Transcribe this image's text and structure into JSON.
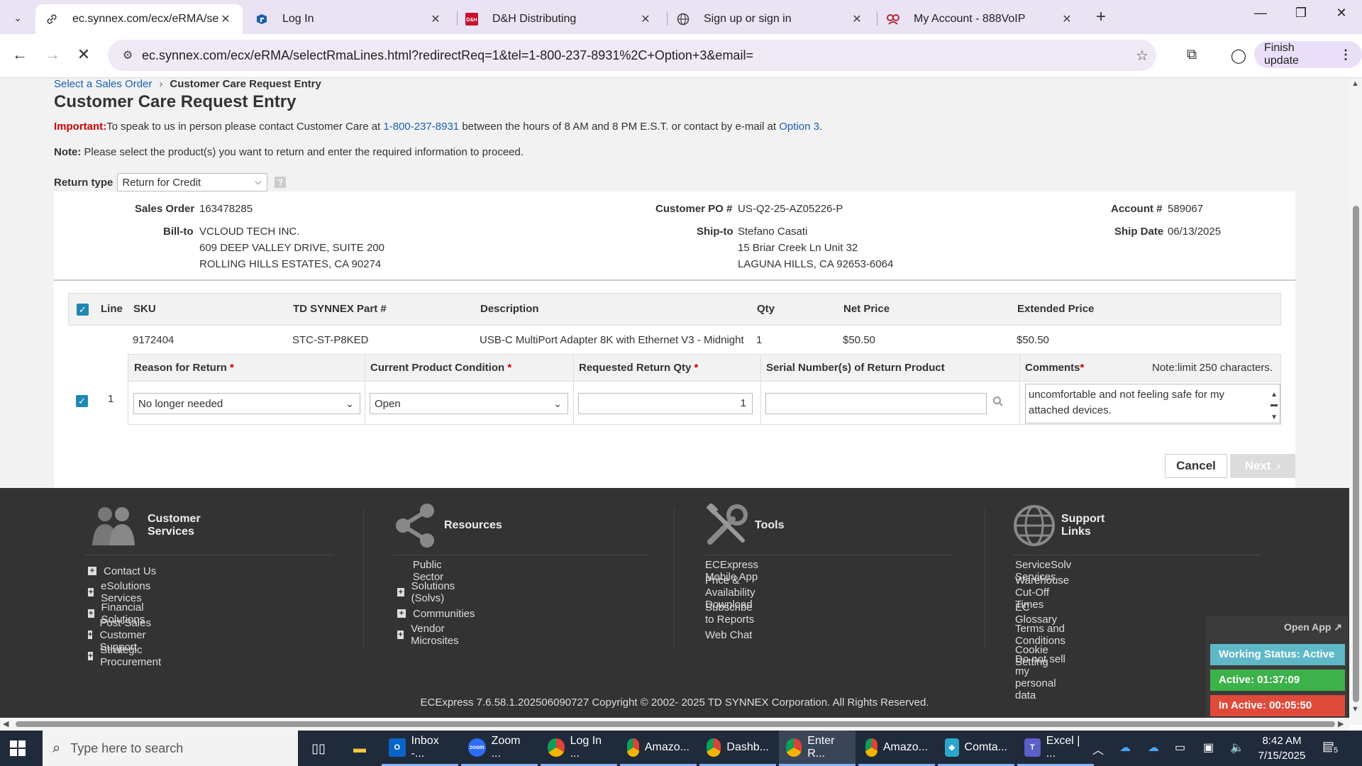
{
  "browser": {
    "tabs": [
      {
        "title": "ec.synnex.com/ecx/eRMA/selec",
        "active": true,
        "icon": "link-icon"
      },
      {
        "title": "Log In",
        "active": false,
        "icon": "app-icon"
      },
      {
        "title": "D&H Distributing",
        "active": false,
        "icon": "dh-icon"
      },
      {
        "title": "Sign up or sign in",
        "active": false,
        "icon": "globe-icon"
      },
      {
        "title": "My Account - 888VoIP",
        "active": false,
        "icon": "voip-icon"
      }
    ],
    "url": "ec.synnex.com/ecx/eRMA/selectRmaLines.html?redirectReq=1&tel=1-800-237-8931%2C+Option+3&email=",
    "finish_update": "Finish update"
  },
  "breadcrumb": {
    "link": "Select a Sales Order",
    "current": "Customer Care Request Entry"
  },
  "page_title": "Customer Care Request Entry",
  "important": {
    "label": "Important:",
    "text1": "To speak to us in person please contact Customer Care at ",
    "phone": "1-800-237-8931",
    "text2": " between the hours of 8 AM and 8 PM E.S.T. or contact by e-mail at ",
    "option": "Option 3",
    "text3": "."
  },
  "note": {
    "label": "Note:",
    "text": " Please select the product(s) you want to return and enter the required information to proceed."
  },
  "return_type": {
    "label": "Return type",
    "value": "Return for Credit",
    "help": "?"
  },
  "order": {
    "sales_order_label": "Sales Order",
    "sales_order": "163478285",
    "bill_to_label": "Bill-to",
    "bill_to": [
      "VCLOUD TECH INC.",
      "609 DEEP VALLEY DRIVE, SUITE 200",
      "ROLLING HILLS ESTATES, CA 90274"
    ],
    "customer_po_label": "Customer PO #",
    "customer_po": "US-Q2-25-AZ05226-P",
    "ship_to_label": "Ship-to",
    "ship_to": [
      "Stefano Casati",
      "15 Briar Creek Ln Unit 32",
      "LAGUNA HILLS, CA 92653-6064"
    ],
    "account_label": "Account #",
    "account": "589067",
    "ship_date_label": "Ship Date",
    "ship_date": "06/13/2025"
  },
  "lines_table": {
    "headers": {
      "line": "Line",
      "sku": "SKU",
      "part": "TD SYNNEX Part #",
      "desc": "Description",
      "qty": "Qty",
      "net": "Net Price",
      "ext": "Extended Price"
    },
    "row": {
      "line": "1",
      "sku": "9172404",
      "part": "STC-ST-P8KED",
      "desc": "USB-C MultiPort Adapter 8K with Ethernet V3 - Midnight",
      "qty": "1",
      "net": "$50.50",
      "ext": "$50.50"
    }
  },
  "return_form": {
    "reason_label": "Reason for Return",
    "condition_label": "Current Product Condition",
    "qty_label": "Requested Return Qty",
    "serial_label": "Serial Number(s) of Return Product",
    "comments_label": "Comments",
    "note_limit": "Note:limit 250 characters.",
    "required_mark": "*",
    "reason_value": "No longer needed",
    "condition_value": "Open",
    "qty_value": "1",
    "serial_value": "",
    "comments_value": "uncomfortable and not feeling safe for my attached devices."
  },
  "buttons": {
    "cancel": "Cancel",
    "next": "Next"
  },
  "footer": {
    "columns": [
      {
        "title": "Customer Services",
        "items": [
          {
            "label": "Contact Us",
            "plus": true
          },
          {
            "label": "eSolutions Services",
            "plus": true
          },
          {
            "label": "Financial Solutions",
            "plus": true
          },
          {
            "label": "Post-Sales Customer Support",
            "plus": true
          },
          {
            "label": "Strategic Procurement",
            "plus": true
          }
        ]
      },
      {
        "title": "Resources",
        "items": [
          {
            "label": "Public Sector",
            "plus": false
          },
          {
            "label": "Solutions (Solvs)",
            "plus": true
          },
          {
            "label": "Communities",
            "plus": true
          },
          {
            "label": "Vendor Microsites",
            "plus": true
          }
        ]
      },
      {
        "title": "Tools",
        "items": [
          {
            "label": "ECExpress Mobile App",
            "plus": false
          },
          {
            "label": "Price & Availability Download",
            "plus": false
          },
          {
            "label": "Subscribe to Reports",
            "plus": false
          },
          {
            "label": "Web Chat",
            "plus": false
          }
        ]
      },
      {
        "title": "Support Links",
        "items": [
          {
            "label": "ServiceSolv Services",
            "plus": false
          },
          {
            "label": "Warehouse Cut-Off Times",
            "plus": false
          },
          {
            "label": "EC Glossary",
            "plus": false
          },
          {
            "label": "Terms and Conditions",
            "plus": false
          },
          {
            "label": "Cookie Setting",
            "plus": false
          },
          {
            "label": "Do not sell my personal data",
            "plus": false
          }
        ]
      }
    ],
    "copyright": "ECExpress 7.6.58.1.202506090727 Copyright © 2002- 2025 TD SYNNEX Corporation. All Rights Reserved."
  },
  "widget": {
    "open_app": "Open App ↗",
    "working_status": "Working Status: Active",
    "active": "Active: 01:37:09",
    "inactive": "In Active: 00:05:50"
  },
  "taskbar": {
    "search_placeholder": "Type here to search",
    "apps": [
      {
        "label": "Inbox -...",
        "icon": "outlook-icon",
        "color": "#0a64c8",
        "glyph": "O"
      },
      {
        "label": "Zoom ...",
        "icon": "zoom-icon",
        "color": "#2d6cf5",
        "glyph": "zoom"
      },
      {
        "label": "Log In ...",
        "icon": "chrome-icon",
        "color": "#db4437",
        "glyph": "●"
      },
      {
        "label": "Amazo...",
        "icon": "chrome-icon",
        "color": "#db4437",
        "glyph": "●"
      },
      {
        "label": "Dashb...",
        "icon": "chrome-icon",
        "color": "#db4437",
        "glyph": "●"
      },
      {
        "label": "Enter R...",
        "icon": "chrome-icon",
        "color": "#db4437",
        "glyph": "●"
      },
      {
        "label": "Amazo...",
        "icon": "chrome-icon",
        "color": "#db4437",
        "glyph": "●"
      },
      {
        "label": "Comta...",
        "icon": "comtact-icon",
        "color": "#2aa6c9",
        "glyph": "◆"
      },
      {
        "label": "Excel | ...",
        "icon": "teams-icon",
        "color": "#5b5fc7",
        "glyph": "T"
      }
    ],
    "time": "8:42 AM",
    "date": "7/15/2025",
    "notifications": "5"
  },
  "colors": {
    "accent": "#1e88b5",
    "link": "#1a5fb4",
    "required": "#cc0000",
    "footer_bg": "#333333"
  }
}
